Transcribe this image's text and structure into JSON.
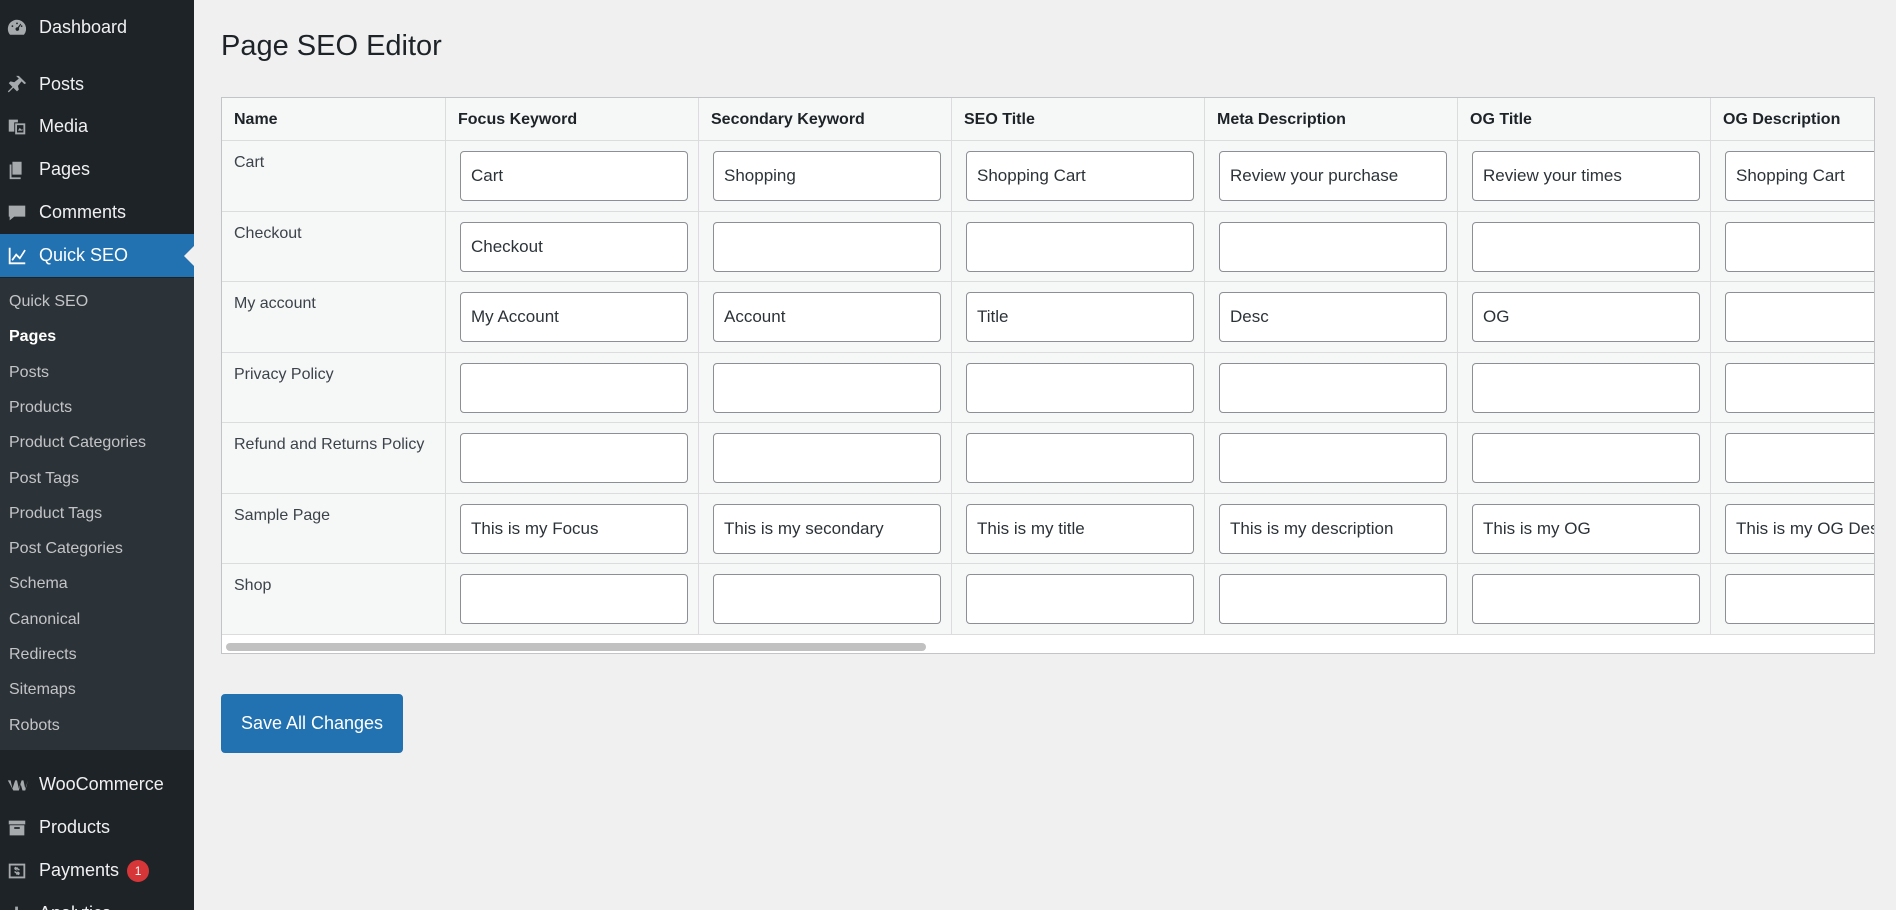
{
  "sidebar": {
    "top_items": [
      {
        "label": "Dashboard",
        "icon": "dashboard-icon"
      },
      {
        "label": "Posts",
        "icon": "pin-icon"
      },
      {
        "label": "Media",
        "icon": "media-icon"
      },
      {
        "label": "Pages",
        "icon": "pages-icon"
      },
      {
        "label": "Comments",
        "icon": "comment-icon"
      },
      {
        "label": "Quick SEO",
        "icon": "chart-line-icon",
        "active": true
      }
    ],
    "submenu": [
      "Quick SEO",
      "Pages",
      "Posts",
      "Products",
      "Product Categories",
      "Post Tags",
      "Product Tags",
      "Post Categories",
      "Schema",
      "Canonical",
      "Redirects",
      "Sitemaps",
      "Robots"
    ],
    "submenu_current": "Pages",
    "bottom_items": [
      {
        "label": "WooCommerce",
        "icon": "woo-icon"
      },
      {
        "label": "Products",
        "icon": "archive-icon"
      },
      {
        "label": "Payments",
        "icon": "payments-icon",
        "badge": "1"
      },
      {
        "label": "Analytics",
        "icon": "analytics-icon"
      }
    ]
  },
  "page": {
    "title": "Page SEO Editor",
    "save_label": "Save All Changes"
  },
  "table": {
    "columns": [
      "Name",
      "Focus Keyword",
      "Secondary Keyword",
      "SEO Title",
      "Meta Description",
      "OG Title",
      "OG Description"
    ],
    "rows": [
      {
        "name": "Cart",
        "values": [
          "Cart",
          "Shopping",
          "Shopping Cart",
          "Review your purchase",
          "Review your times",
          "Shopping Cart"
        ]
      },
      {
        "name": "Checkout",
        "values": [
          "Checkout",
          "",
          "",
          "",
          "",
          ""
        ]
      },
      {
        "name": "My account",
        "values": [
          "My Account",
          "Account",
          "Title",
          "Desc",
          "OG",
          ""
        ]
      },
      {
        "name": "Privacy Policy",
        "values": [
          "",
          "",
          "",
          "",
          "",
          ""
        ]
      },
      {
        "name": "Refund and Returns Policy",
        "values": [
          "",
          "",
          "",
          "",
          "",
          ""
        ]
      },
      {
        "name": "Sample Page",
        "values": [
          "This is my Focus",
          "This is my secondary",
          "This is my title",
          "This is my description",
          "This is my OG",
          "This is my OG Description"
        ]
      },
      {
        "name": "Shop",
        "values": [
          "",
          "",
          "",
          "",
          "",
          ""
        ]
      }
    ]
  },
  "colors": {
    "sidebar_bg": "#1d2327",
    "submenu_bg": "#2c3338",
    "accent": "#2271b1",
    "badge": "#d63638"
  }
}
